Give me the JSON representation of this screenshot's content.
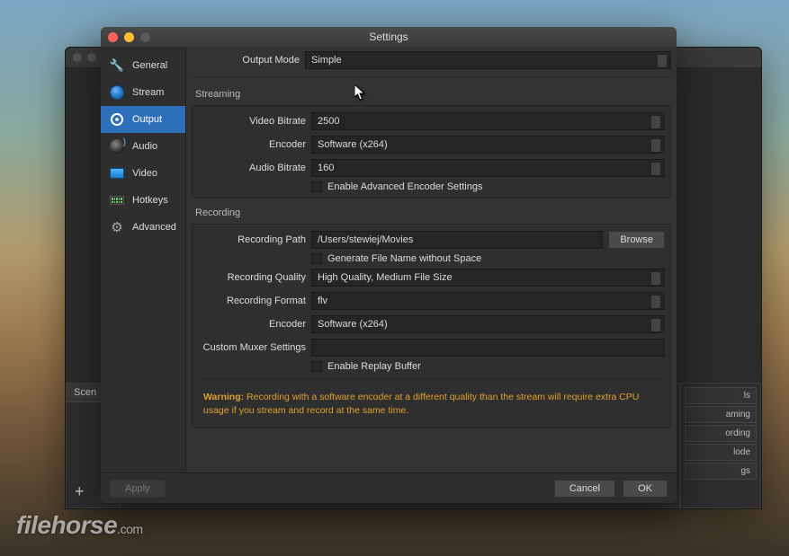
{
  "window": {
    "title": "Settings"
  },
  "sidebar": {
    "items": [
      {
        "label": "General"
      },
      {
        "label": "Stream"
      },
      {
        "label": "Output"
      },
      {
        "label": "Audio"
      },
      {
        "label": "Video"
      },
      {
        "label": "Hotkeys"
      },
      {
        "label": "Advanced"
      }
    ]
  },
  "output": {
    "mode_label": "Output Mode",
    "mode_value": "Simple"
  },
  "streaming": {
    "header": "Streaming",
    "video_bitrate_label": "Video Bitrate",
    "video_bitrate_value": "2500",
    "encoder_label": "Encoder",
    "encoder_value": "Software (x264)",
    "audio_bitrate_label": "Audio Bitrate",
    "audio_bitrate_value": "160",
    "advanced_checkbox": "Enable Advanced Encoder Settings"
  },
  "recording": {
    "header": "Recording",
    "path_label": "Recording Path",
    "path_value": "/Users/stewiej/Movies",
    "browse_label": "Browse",
    "gen_filename_checkbox": "Generate File Name without Space",
    "quality_label": "Recording Quality",
    "quality_value": "High Quality, Medium File Size",
    "format_label": "Recording Format",
    "format_value": "flv",
    "encoder_label": "Encoder",
    "encoder_value": "Software (x264)",
    "muxer_label": "Custom Muxer Settings",
    "muxer_value": "",
    "replay_checkbox": "Enable Replay Buffer"
  },
  "warning": {
    "prefix": "Warning:",
    "text": " Recording with a software encoder at a different quality than the stream will require extra CPU usage if you stream and record at the same time."
  },
  "footer": {
    "apply": "Apply",
    "cancel": "Cancel",
    "ok": "OK"
  },
  "bg": {
    "scenes": "Scen",
    "side_items": [
      "ls",
      "aming",
      "ording",
      "lode",
      "gs"
    ]
  },
  "watermark": {
    "brand": "filehorse",
    "tld": ".com"
  }
}
